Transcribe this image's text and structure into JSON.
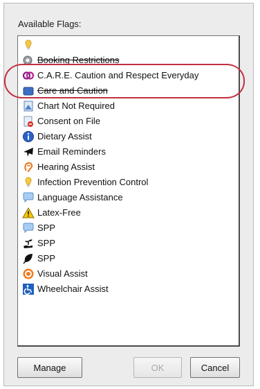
{
  "dialog": {
    "title": "Available Flags:",
    "flags": [
      {
        "label": "",
        "icon": "lightbulb-icon"
      },
      {
        "label": "Booking Restrictions",
        "icon": "booking-icon"
      },
      {
        "label": "C.A.R.E. Caution and Respect Everyday",
        "icon": "care-rings-icon"
      },
      {
        "label": "Care and Caution",
        "icon": "care-caution-icon"
      },
      {
        "label": "Chart Not Required",
        "icon": "chart-icon"
      },
      {
        "label": "Consent on File",
        "icon": "consent-icon"
      },
      {
        "label": "Dietary Assist",
        "icon": "info-icon"
      },
      {
        "label": "Email Reminders",
        "icon": "airplane-icon"
      },
      {
        "label": "Hearing Assist",
        "icon": "ear-icon"
      },
      {
        "label": "Infection Prevention Control",
        "icon": "lightbulb-icon"
      },
      {
        "label": "Language Assistance",
        "icon": "speech-bubble-icon"
      },
      {
        "label": "Latex-Free",
        "icon": "warning-icon"
      },
      {
        "label": "SPP",
        "icon": "speech-bubble-icon"
      },
      {
        "label": "SPP",
        "icon": "hand-plant-icon"
      },
      {
        "label": "SPP",
        "icon": "leaf-icon"
      },
      {
        "label": "Visual Assist",
        "icon": "eye-target-icon"
      },
      {
        "label": "Wheelchair Assist",
        "icon": "wheelchair-icon"
      }
    ],
    "buttons": {
      "manage": "Manage",
      "ok": "OK",
      "cancel": "Cancel"
    }
  }
}
